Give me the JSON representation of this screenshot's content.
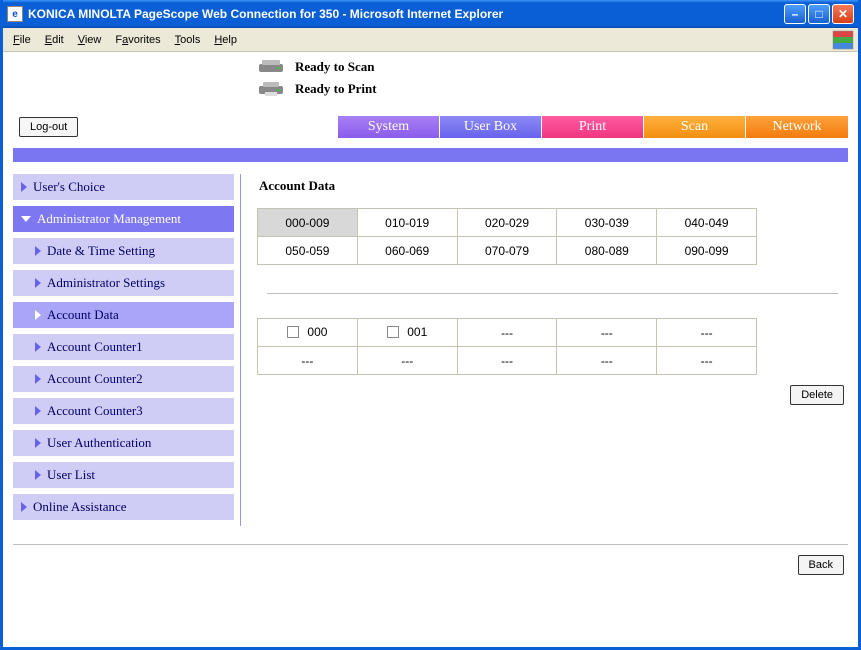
{
  "window": {
    "title": "KONICA MINOLTA PageScope Web Connection for 350 - Microsoft Internet Explorer"
  },
  "menu": {
    "file": "File",
    "edit": "Edit",
    "view": "View",
    "favorites": "Favorites",
    "tools": "Tools",
    "help": "Help"
  },
  "status": {
    "scan": "Ready to Scan",
    "print": "Ready to Print"
  },
  "buttons": {
    "logout": "Log-out",
    "delete": "Delete",
    "back": "Back"
  },
  "tabs": {
    "system": "System",
    "userbox": "User Box",
    "print": "Print",
    "scan": "Scan",
    "network": "Network"
  },
  "sidebar": {
    "users_choice": "User's Choice",
    "admin_mgmt": "Administrator Management",
    "date_time": "Date & Time Setting",
    "admin_settings": "Administrator Settings",
    "account_data": "Account Data",
    "counter1": "Account Counter1",
    "counter2": "Account Counter2",
    "counter3": "Account Counter3",
    "user_auth": "User Authentication",
    "user_list": "User List",
    "online": "Online Assistance"
  },
  "panel": {
    "title": "Account Data",
    "ranges": [
      [
        "000-009",
        "010-019",
        "020-029",
        "030-039",
        "040-049"
      ],
      [
        "050-059",
        "060-069",
        "070-079",
        "080-089",
        "090-099"
      ]
    ],
    "selected_range": "000-009",
    "accounts": [
      [
        {
          "label": "000",
          "checkbox": true
        },
        {
          "label": "001",
          "checkbox": true
        },
        {
          "label": "---"
        },
        {
          "label": "---"
        },
        {
          "label": "---"
        }
      ],
      [
        {
          "label": "---"
        },
        {
          "label": "---"
        },
        {
          "label": "---"
        },
        {
          "label": "---"
        },
        {
          "label": "---"
        }
      ]
    ]
  }
}
